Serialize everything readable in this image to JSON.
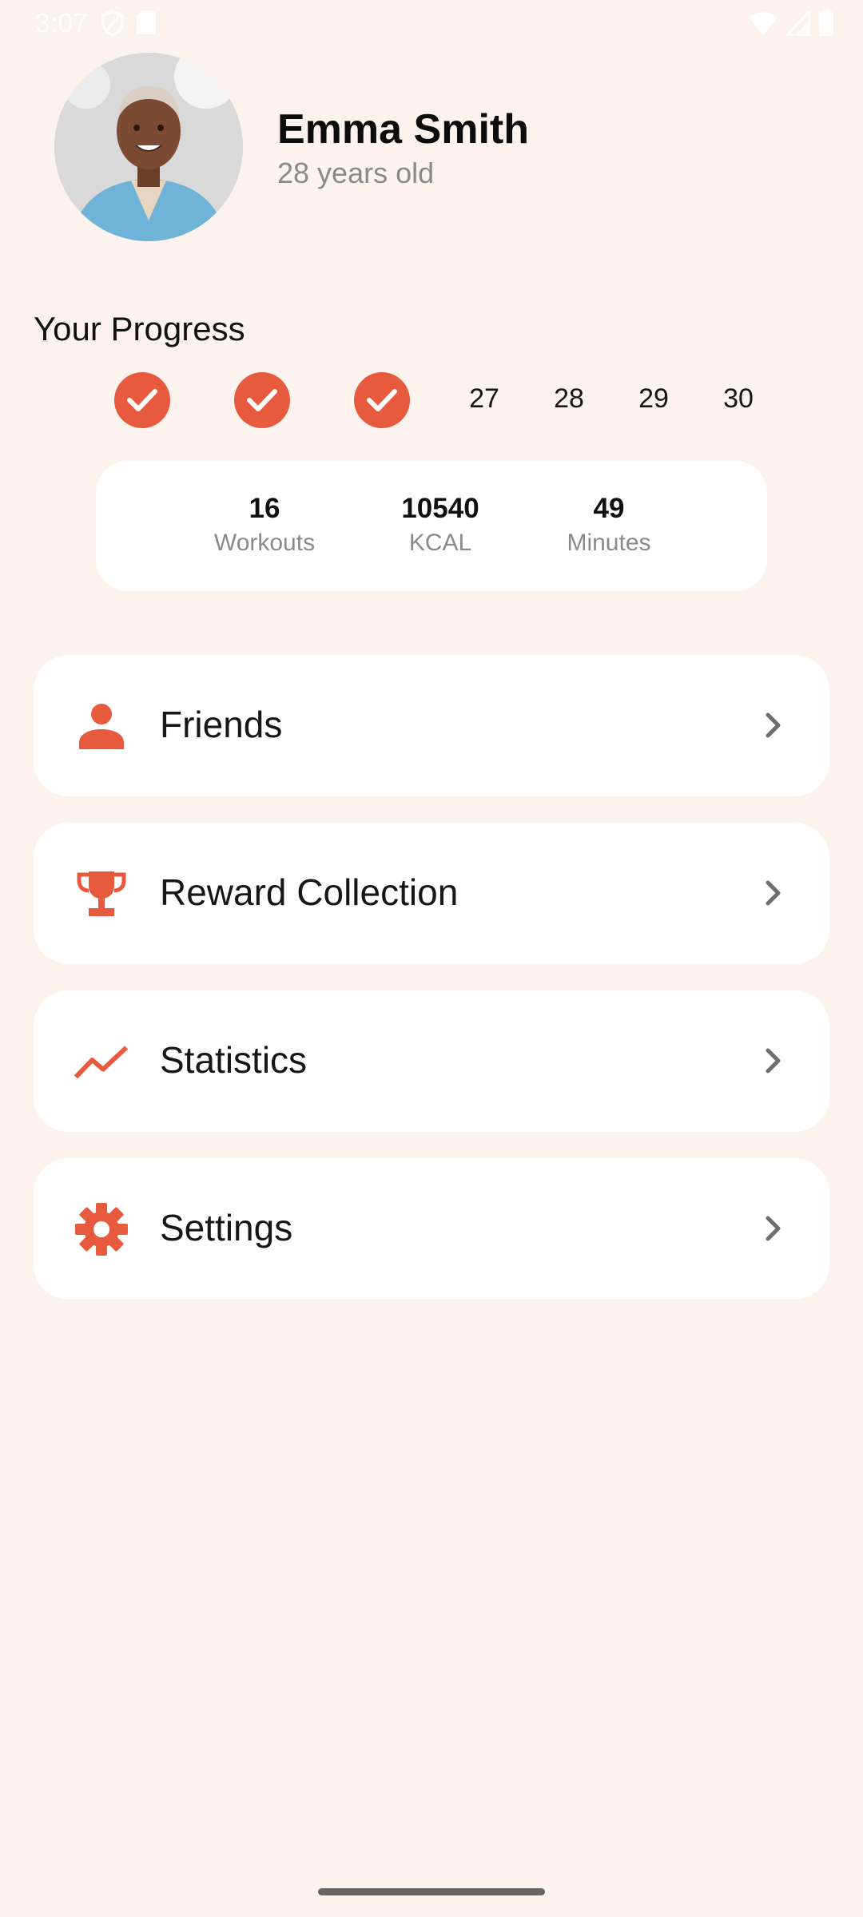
{
  "status_bar": {
    "time": "3:07",
    "left_icons": [
      "shield-icon",
      "sd-card-icon"
    ],
    "right_icons": [
      "wifi-icon",
      "signal-icon",
      "battery-icon"
    ]
  },
  "profile": {
    "name": "Emma Smith",
    "age": "28 years old"
  },
  "progress": {
    "title": "Your Progress",
    "completed_days": 3,
    "days": [
      "27",
      "28",
      "29",
      "30"
    ]
  },
  "stats": [
    {
      "value": "16",
      "label": "Workouts"
    },
    {
      "value": "10540",
      "label": "KCAL"
    },
    {
      "value": "49",
      "label": "Minutes"
    }
  ],
  "menu": [
    {
      "label": "Friends",
      "icon": "person-icon"
    },
    {
      "label": "Reward Collection",
      "icon": "trophy-icon"
    },
    {
      "label": "Statistics",
      "icon": "trending-up-icon"
    },
    {
      "label": "Settings",
      "icon": "gear-icon"
    }
  ],
  "colors": {
    "accent": "#e85a3e",
    "background": "#fcf3ef",
    "card": "#ffffff",
    "muted_text": "#8a8a8a"
  }
}
